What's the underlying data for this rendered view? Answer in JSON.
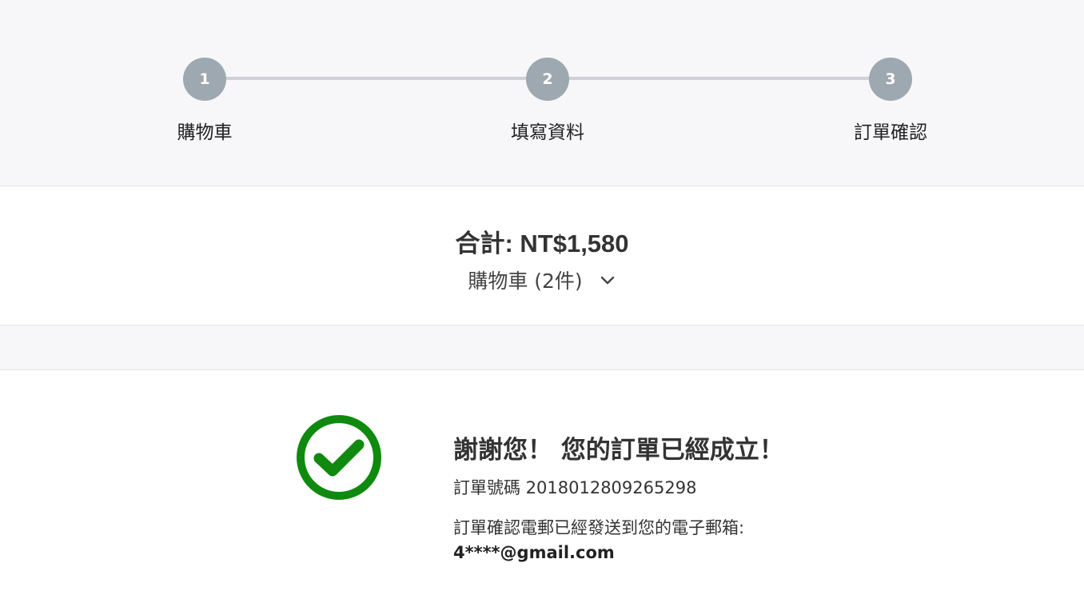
{
  "stepper": {
    "steps": [
      {
        "number": "1",
        "label": "購物車"
      },
      {
        "number": "2",
        "label": "填寫資料"
      },
      {
        "number": "3",
        "label": "訂單確認"
      }
    ]
  },
  "summary": {
    "total_label": "合計: NT$1,580",
    "cart_toggle_label": "購物車 (2件)",
    "cart_toggle_icon": "chevron-down-icon"
  },
  "confirmation": {
    "icon": "check-circle-icon",
    "icon_color": "#0f8a0f",
    "title": "謝謝您！ 您的訂單已經成立！",
    "order_number_text": "訂單號碼 2018012809265298",
    "email_note": "訂單確認電郵已經發送到您的電子郵箱:",
    "email": "4****@gmail.com"
  }
}
